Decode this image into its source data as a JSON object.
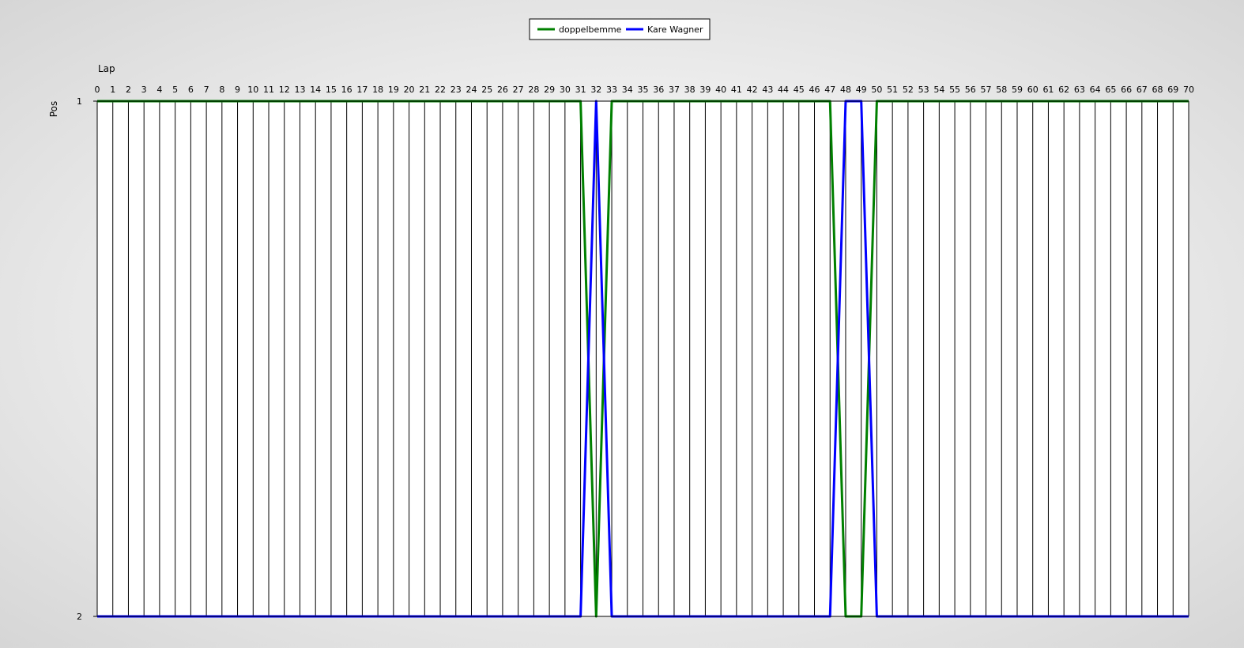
{
  "chart_data": {
    "type": "line",
    "xlabel": "Lap",
    "ylabel": "Pos",
    "x_axis_position": "top",
    "y_inverted": true,
    "grid": {
      "vertical": true,
      "horizontal": false
    },
    "legend_position": "top-center",
    "xlim": [
      0,
      70
    ],
    "ylim": [
      1,
      2
    ],
    "y_ticks": [
      1,
      2
    ],
    "x": [
      0,
      1,
      2,
      3,
      4,
      5,
      6,
      7,
      8,
      9,
      10,
      11,
      12,
      13,
      14,
      15,
      16,
      17,
      18,
      19,
      20,
      21,
      22,
      23,
      24,
      25,
      26,
      27,
      28,
      29,
      30,
      31,
      32,
      33,
      34,
      35,
      36,
      37,
      38,
      39,
      40,
      41,
      42,
      43,
      44,
      45,
      46,
      47,
      48,
      49,
      50,
      51,
      52,
      53,
      54,
      55,
      56,
      57,
      58,
      59,
      60,
      61,
      62,
      63,
      64,
      65,
      66,
      67,
      68,
      69,
      70
    ],
    "series": [
      {
        "name": "doppelbemme",
        "color": "#008000",
        "values": [
          1,
          1,
          1,
          1,
          1,
          1,
          1,
          1,
          1,
          1,
          1,
          1,
          1,
          1,
          1,
          1,
          1,
          1,
          1,
          1,
          1,
          1,
          1,
          1,
          1,
          1,
          1,
          1,
          1,
          1,
          1,
          1,
          2,
          1,
          1,
          1,
          1,
          1,
          1,
          1,
          1,
          1,
          1,
          1,
          1,
          1,
          1,
          1,
          2,
          2,
          1,
          1,
          1,
          1,
          1,
          1,
          1,
          1,
          1,
          1,
          1,
          1,
          1,
          1,
          1,
          1,
          1,
          1,
          1,
          1,
          1
        ]
      },
      {
        "name": "Kare Wagner",
        "color": "#0000ff",
        "values": [
          2,
          2,
          2,
          2,
          2,
          2,
          2,
          2,
          2,
          2,
          2,
          2,
          2,
          2,
          2,
          2,
          2,
          2,
          2,
          2,
          2,
          2,
          2,
          2,
          2,
          2,
          2,
          2,
          2,
          2,
          2,
          2,
          1,
          2,
          2,
          2,
          2,
          2,
          2,
          2,
          2,
          2,
          2,
          2,
          2,
          2,
          2,
          2,
          1,
          1,
          2,
          2,
          2,
          2,
          2,
          2,
          2,
          2,
          2,
          2,
          2,
          2,
          2,
          2,
          2,
          2,
          2,
          2,
          2,
          2,
          2
        ]
      }
    ]
  }
}
